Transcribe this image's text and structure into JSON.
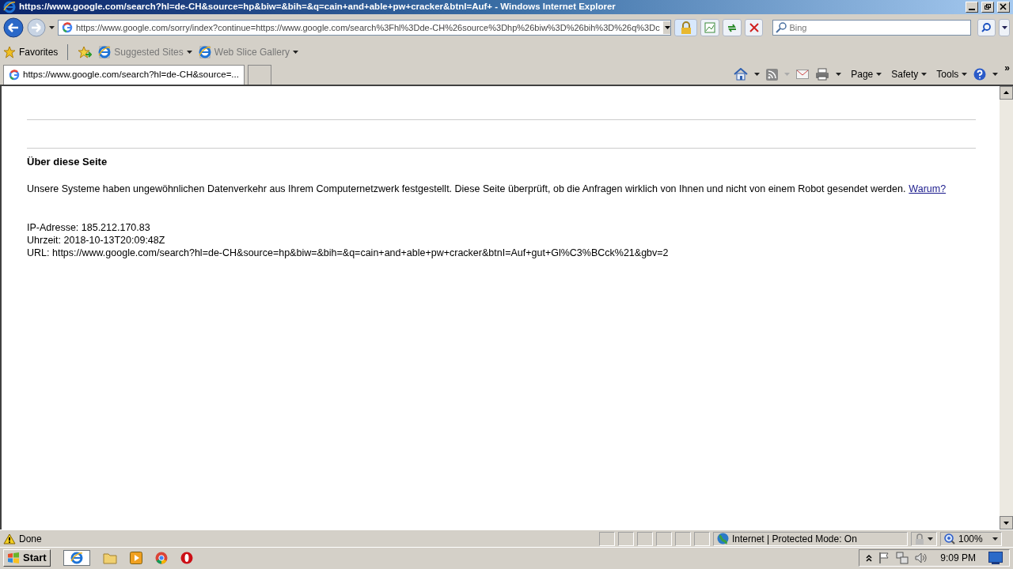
{
  "window": {
    "title": "https://www.google.com/search?hl=de-CH&source=hp&biw=&bih=&q=cain+and+able+pw+cracker&btnI=Auf+ - Windows Internet Explorer"
  },
  "address_bar": {
    "url": "https://www.google.com/sorry/index?continue=https://www.google.com/search%3Fhl%3Dde-CH%26source%3Dhp%26biw%3D%26bih%3D%26q%3Dc",
    "search_placeholder": "Bing"
  },
  "favorites_bar": {
    "label": "Favorites",
    "items": [
      {
        "label": "Suggested Sites"
      },
      {
        "label": "Web Slice Gallery"
      }
    ]
  },
  "tabs": [
    {
      "label": "https://www.google.com/search?hl=de-CH&source=...",
      "selected": true
    }
  ],
  "command_bar": {
    "menus": [
      "Page",
      "Safety",
      "Tools"
    ],
    "overflow": "»"
  },
  "page": {
    "heading": "Über diese Seite",
    "message": "Unsere Systeme haben ungewöhnlichen Datenverkehr aus Ihrem Computernetzwerk festgestellt. Diese Seite überprüft, ob die Anfragen wirklich von Ihnen und nicht von einem Robot gesendet werden.",
    "link": "Warum?",
    "details": [
      "IP-Adresse: 185.212.170.83",
      "Uhrzeit: 2018-10-13T20:09:48Z",
      "URL: https://www.google.com/search?hl=de-CH&source=hp&biw=&bih=&q=cain+and+able+pw+cracker&btnI=Auf+gut+Gl%C3%BCck%21&gbv=2"
    ]
  },
  "status_bar": {
    "text": "Done",
    "zone": "Internet | Protected Mode: On",
    "zoom": "100%"
  },
  "taskbar": {
    "start": "Start",
    "time": "9:09 PM"
  }
}
